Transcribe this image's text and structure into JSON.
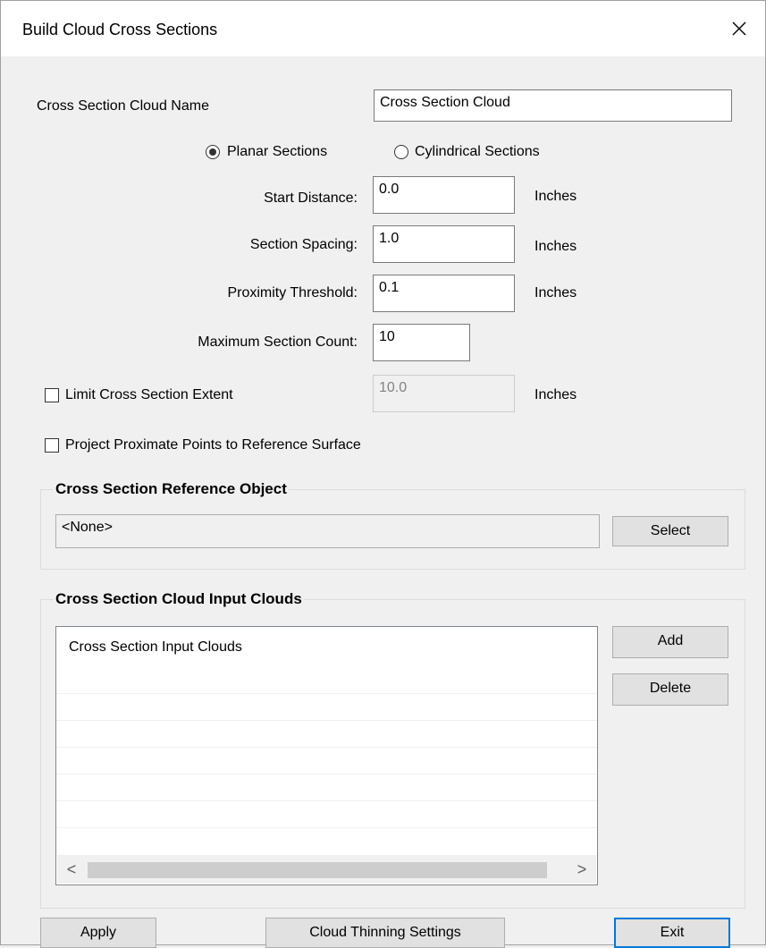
{
  "window": {
    "title": "Build Cloud Cross Sections",
    "close_icon": "close-icon"
  },
  "cloud_name": {
    "label": "Cross Section Cloud Name",
    "value": "Cross Section Cloud"
  },
  "section_type": {
    "options": [
      {
        "label": "Planar Sections",
        "selected": true
      },
      {
        "label": "Cylindrical Sections",
        "selected": false
      }
    ]
  },
  "fields": {
    "start_distance": {
      "label": "Start Distance:",
      "value": "0.0",
      "unit": "Inches"
    },
    "section_spacing": {
      "label": "Section Spacing:",
      "value": "1.0",
      "unit": "Inches"
    },
    "proximity_threshold": {
      "label": "Proximity Threshold:",
      "value": "0.1",
      "unit": "Inches"
    },
    "max_section_count": {
      "label": "Maximum Section Count:",
      "value": "10"
    }
  },
  "limit_extent": {
    "label": "Limit Cross Section Extent",
    "checked": false,
    "value": "10.0",
    "unit": "Inches"
  },
  "project_points": {
    "label": "Project Proximate Points to Reference Surface",
    "checked": false
  },
  "reference_object": {
    "title": "Cross Section Reference Object",
    "value": "<None>",
    "select_label": "Select"
  },
  "input_clouds": {
    "title": "Cross Section Cloud Input Clouds",
    "header": "Cross Section Input Clouds",
    "add_label": "Add",
    "delete_label": "Delete",
    "scroll_left": "<",
    "scroll_right": ">"
  },
  "footer": {
    "apply_label": "Apply",
    "thinning_label": "Cloud Thinning Settings",
    "exit_label": "Exit"
  }
}
